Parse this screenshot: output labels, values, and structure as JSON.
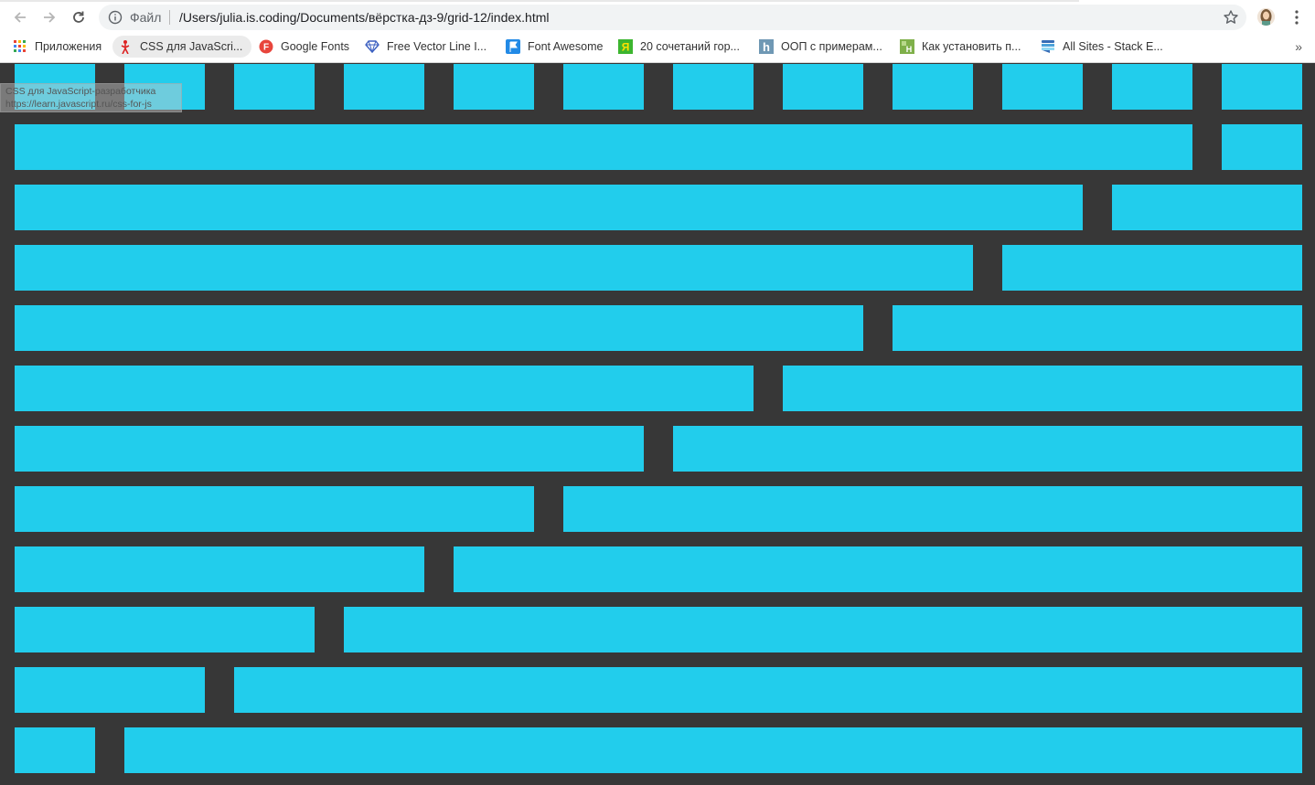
{
  "toolbar": {
    "scheme_label": "Файл",
    "url": "/Users/julia.is.coding/Documents/вёрстка-дз-9/grid-12/index.html"
  },
  "bookmarks": {
    "apps": "Приложения",
    "items": [
      {
        "label": "CSS для JavaScri...",
        "icon": "learn-js-icon",
        "active": true
      },
      {
        "label": "Google Fonts",
        "icon": "google-fonts-icon"
      },
      {
        "label": "Free Vector Line I...",
        "icon": "diamond-icon"
      },
      {
        "label": "Font Awesome",
        "icon": "flag-icon"
      },
      {
        "label": "20 сочетаний гор...",
        "icon": "green-square-icon"
      },
      {
        "label": "ООП с примерам...",
        "icon": "h-icon"
      },
      {
        "label": "Как установить п...",
        "icon": "green-h-icon"
      },
      {
        "label": "All Sites - Stack E...",
        "icon": "stack-exchange-icon"
      }
    ],
    "overflow": "»"
  },
  "tooltip": {
    "title": "CSS для JavaScript-разработчика",
    "url": "https://learn.javascript.ru/css-for-js"
  },
  "grid": {
    "columns": 12,
    "rows": [
      [
        1,
        1,
        1,
        1,
        1,
        1,
        1,
        1,
        1,
        1,
        1,
        1
      ],
      [
        11,
        1
      ],
      [
        10,
        2
      ],
      [
        9,
        3
      ],
      [
        8,
        4
      ],
      [
        7,
        5
      ],
      [
        6,
        6
      ],
      [
        5,
        7
      ],
      [
        4,
        8
      ],
      [
        3,
        9
      ],
      [
        2,
        10
      ],
      [
        1,
        11
      ]
    ],
    "cell_color": "#22cdec",
    "background_color": "#373737"
  }
}
